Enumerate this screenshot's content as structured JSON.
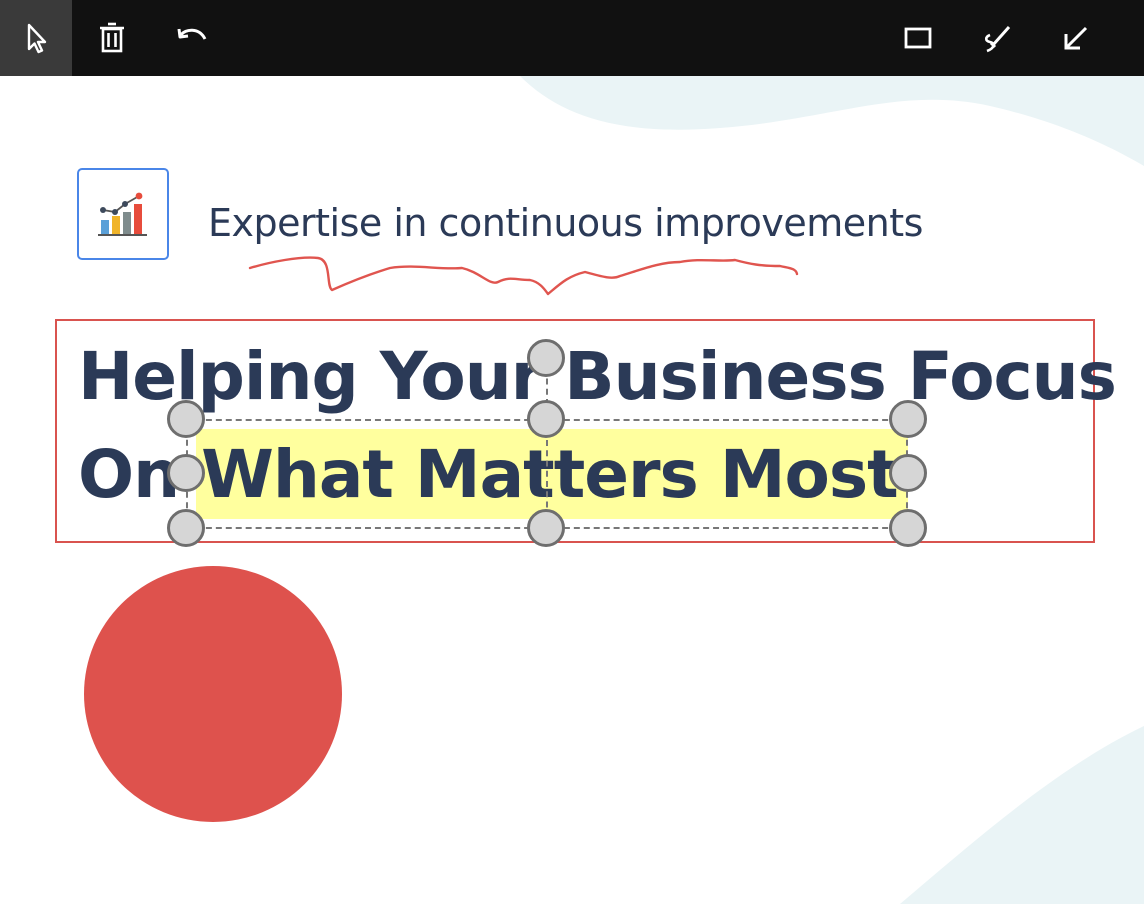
{
  "toolbar": {
    "tools": [
      {
        "name": "select-tool",
        "icon": "cursor-icon",
        "active": true
      },
      {
        "name": "delete-tool",
        "icon": "trash-icon"
      },
      {
        "name": "undo-tool",
        "icon": "undo-icon"
      },
      {
        "name": "rectangle-tool",
        "icon": "rectangle-icon"
      },
      {
        "name": "highlighter-tool",
        "icon": "highlighter-icon"
      },
      {
        "name": "arrow-tool",
        "icon": "arrow-down-left-icon"
      }
    ]
  },
  "slide": {
    "tagline": "Expertise in continuous improvements",
    "heading_line1": "Helping Your Business Focus",
    "heading_line2_prefix": "On ",
    "heading_line2_highlight": "What Matters Most",
    "colors": {
      "heading": "#2b3a57",
      "highlight": "#ffff78",
      "annotation_red": "#d9534f",
      "circle": "#de524d",
      "logo_border": "#4a86e8",
      "toolbar": "#111111"
    }
  }
}
